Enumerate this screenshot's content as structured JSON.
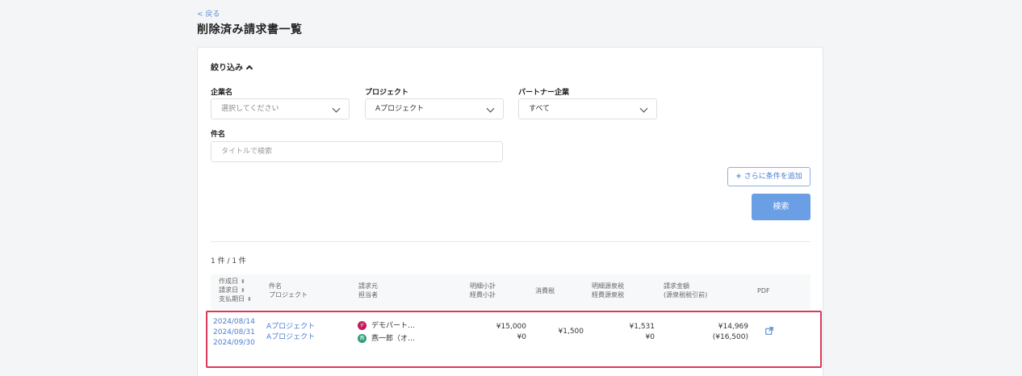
{
  "nav": {
    "back_label": "< 戻る"
  },
  "page": {
    "title": "削除済み請求書一覧"
  },
  "filter": {
    "title": "絞り込み",
    "company": {
      "label": "企業名",
      "value": "選択してください"
    },
    "project": {
      "label": "プロジェクト",
      "value": "Aプロジェクト"
    },
    "partner": {
      "label": "パートナー企業",
      "value": "すべて"
    },
    "subject": {
      "label": "件名",
      "placeholder": "タイトルで検索"
    },
    "add_condition_label": "さらに条件を追加",
    "search_label": "検索"
  },
  "results": {
    "count_text": "1 件 / 1 件"
  },
  "table": {
    "headers": {
      "created": "作成日",
      "billed": "請求日",
      "due": "支払期日",
      "subject": "件名",
      "project": "プロジェクト",
      "billing_to": "請求元",
      "assignee": "担当者",
      "detail_subtotal": "明細小計",
      "expense_subtotal": "経費小計",
      "tax": "消費税",
      "detail_withholding": "明細源泉税",
      "expense_withholding": "経費源泉税",
      "amount": "請求金額",
      "amount_note": "(源泉税税引前)",
      "pdf": "PDF"
    },
    "rows": [
      {
        "created": "2024/08/14",
        "billed": "2024/08/31",
        "due": "2024/09/30",
        "subject": "Aプロジェクト",
        "project": "Aプロジェクト",
        "partner_initial": "デ",
        "partner_name": "デモパート…",
        "person_initial": "燕",
        "person_name": "燕一郎（オ…",
        "detail_subtotal": "¥15,000",
        "expense_subtotal": "¥0",
        "tax": "¥1,500",
        "detail_withholding": "¥1,531",
        "expense_withholding": "¥0",
        "amount": "¥14,969",
        "amount_before": "(¥16,500)"
      }
    ]
  },
  "colors": {
    "accent": "#6a9fe5",
    "link": "#4a7fcf",
    "highlight": "#d83a5a",
    "partner_avatar": "#c2185b",
    "person_avatar": "#2e9e7a"
  },
  "icons": {
    "filter_toggle": "chevron-up-icon",
    "select": "chevron-down-icon",
    "sort": "sort-icon",
    "pdf": "external-link-icon"
  }
}
